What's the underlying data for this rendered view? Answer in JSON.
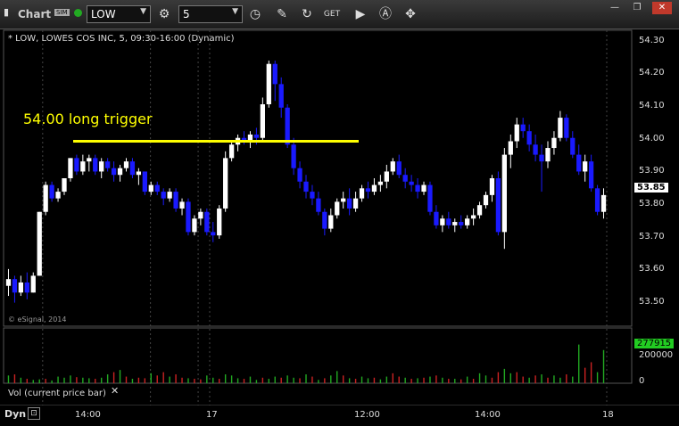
{
  "window": {
    "title": "Chart",
    "sim_badge": "SIM",
    "symbol": "LOW",
    "interval": "5",
    "win_buttons": [
      "—",
      "❐",
      "✕"
    ]
  },
  "chart": {
    "header": "* LOW, LOWES COS INC, 5, 09:30-16:00 (Dynamic)",
    "watermark": "© eSignal, 2014",
    "annotation": "54.00 long trigger",
    "last_price": "53.85",
    "price_ticks": [
      "54.30",
      "54.20",
      "54.10",
      "54.00",
      "53.90",
      "53.80",
      "53.70",
      "53.60",
      "53.50"
    ],
    "time_ticks": [
      "14:00",
      "17",
      "12:00",
      "14:00",
      "18"
    ],
    "volume_label": "Vol (current price bar)",
    "volume_last": "277915",
    "volume_ticks": [
      "200000",
      "0"
    ],
    "footer_mode": "Dyn",
    "colors": {
      "up": "#ffffff",
      "down": "#1a1aff",
      "trigger": "#ffff00",
      "vol_up": "#22aa22",
      "vol_down": "#cc2222"
    }
  },
  "chart_data": {
    "type": "candlestick",
    "ylim": [
      53.45,
      54.33
    ],
    "trigger_level": 54.0,
    "candles": [
      [
        53.57,
        53.62,
        53.54,
        53.59
      ],
      [
        53.59,
        53.6,
        53.52,
        53.55
      ],
      [
        53.55,
        53.6,
        53.54,
        53.58
      ],
      [
        53.58,
        53.61,
        53.53,
        53.55
      ],
      [
        53.55,
        53.61,
        53.55,
        53.6
      ],
      [
        53.6,
        53.79,
        53.6,
        53.79
      ],
      [
        53.79,
        53.88,
        53.78,
        53.87
      ],
      [
        53.87,
        53.88,
        53.82,
        53.83
      ],
      [
        53.83,
        53.86,
        53.82,
        53.85
      ],
      [
        53.85,
        53.89,
        53.84,
        53.89
      ],
      [
        53.89,
        53.95,
        53.88,
        53.95
      ],
      [
        53.95,
        53.96,
        53.9,
        53.91
      ],
      [
        53.91,
        53.96,
        53.9,
        53.94
      ],
      [
        53.94,
        53.96,
        53.91,
        53.95
      ],
      [
        53.95,
        53.96,
        53.9,
        53.91
      ],
      [
        53.91,
        53.95,
        53.89,
        53.94
      ],
      [
        53.94,
        53.95,
        53.91,
        53.92
      ],
      [
        53.92,
        53.94,
        53.88,
        53.9
      ],
      [
        53.9,
        53.93,
        53.88,
        53.92
      ],
      [
        53.92,
        53.95,
        53.91,
        53.94
      ],
      [
        53.94,
        53.95,
        53.89,
        53.9
      ],
      [
        53.9,
        53.92,
        53.87,
        53.91
      ],
      [
        53.91,
        53.91,
        53.84,
        53.85
      ],
      [
        53.85,
        53.88,
        53.84,
        53.87
      ],
      [
        53.87,
        53.88,
        53.84,
        53.85
      ],
      [
        53.85,
        53.86,
        53.81,
        53.83
      ],
      [
        53.83,
        53.86,
        53.82,
        53.85
      ],
      [
        53.85,
        53.86,
        53.79,
        53.8
      ],
      [
        53.8,
        53.83,
        53.78,
        53.82
      ],
      [
        53.82,
        53.83,
        53.72,
        53.73
      ],
      [
        53.73,
        53.78,
        53.72,
        53.77
      ],
      [
        53.77,
        53.8,
        53.75,
        53.79
      ],
      [
        53.79,
        53.8,
        53.72,
        53.73
      ],
      [
        53.73,
        53.76,
        53.7,
        53.72
      ],
      [
        53.72,
        53.81,
        53.71,
        53.8
      ],
      [
        53.8,
        53.97,
        53.79,
        53.95
      ],
      [
        53.95,
        54.0,
        53.94,
        53.99
      ],
      [
        53.99,
        54.02,
        53.97,
        54.01
      ],
      [
        54.01,
        54.03,
        53.99,
        54.0
      ],
      [
        54.0,
        54.03,
        53.98,
        54.02
      ],
      [
        54.02,
        54.04,
        53.99,
        54.01
      ],
      [
        54.01,
        54.13,
        54.0,
        54.11
      ],
      [
        54.11,
        54.24,
        54.1,
        54.23
      ],
      [
        54.23,
        54.24,
        54.12,
        54.17
      ],
      [
        54.17,
        54.19,
        54.07,
        54.1
      ],
      [
        54.1,
        54.11,
        53.98,
        53.99
      ],
      [
        53.99,
        54.01,
        53.9,
        53.92
      ],
      [
        53.92,
        53.94,
        53.86,
        53.88
      ],
      [
        53.88,
        53.9,
        53.83,
        53.85
      ],
      [
        53.85,
        53.87,
        53.81,
        53.83
      ],
      [
        53.83,
        53.85,
        53.78,
        53.79
      ],
      [
        53.79,
        53.8,
        53.72,
        53.74
      ],
      [
        53.74,
        53.8,
        53.73,
        53.78
      ],
      [
        53.78,
        53.83,
        53.77,
        53.82
      ],
      [
        53.82,
        53.85,
        53.8,
        53.83
      ],
      [
        53.83,
        53.86,
        53.78,
        53.8
      ],
      [
        53.8,
        53.85,
        53.79,
        53.83
      ],
      [
        53.83,
        53.87,
        53.82,
        53.86
      ],
      [
        53.86,
        53.88,
        53.83,
        53.85
      ],
      [
        53.85,
        53.89,
        53.84,
        53.87
      ],
      [
        53.87,
        53.9,
        53.85,
        53.88
      ],
      [
        53.88,
        53.93,
        53.86,
        53.91
      ],
      [
        53.91,
        53.95,
        53.9,
        53.94
      ],
      [
        53.94,
        53.96,
        53.89,
        53.9
      ],
      [
        53.9,
        53.92,
        53.86,
        53.88
      ],
      [
        53.88,
        53.9,
        53.85,
        53.87
      ],
      [
        53.87,
        53.89,
        53.83,
        53.85
      ],
      [
        53.85,
        53.88,
        53.84,
        53.87
      ],
      [
        53.87,
        53.88,
        53.78,
        53.79
      ],
      [
        53.79,
        53.81,
        53.74,
        53.75
      ],
      [
        53.75,
        53.78,
        53.73,
        53.77
      ],
      [
        53.77,
        53.79,
        53.74,
        53.75
      ],
      [
        53.75,
        53.77,
        53.73,
        53.76
      ],
      [
        53.76,
        53.78,
        53.74,
        53.75
      ],
      [
        53.75,
        53.78,
        53.74,
        53.77
      ],
      [
        53.77,
        53.8,
        53.75,
        53.78
      ],
      [
        53.78,
        53.82,
        53.77,
        53.81
      ],
      [
        53.81,
        53.85,
        53.8,
        53.84
      ],
      [
        53.84,
        53.9,
        53.82,
        53.89
      ],
      [
        53.89,
        53.91,
        53.72,
        53.73
      ],
      [
        53.73,
        53.98,
        53.68,
        53.96
      ],
      [
        53.96,
        54.02,
        53.92,
        54.0
      ],
      [
        54.0,
        54.07,
        53.98,
        54.05
      ],
      [
        54.05,
        54.07,
        54.01,
        54.03
      ],
      [
        54.03,
        54.05,
        53.97,
        53.99
      ],
      [
        53.99,
        54.02,
        53.94,
        53.96
      ],
      [
        53.96,
        53.99,
        53.85,
        53.94
      ],
      [
        53.94,
        54.0,
        53.92,
        53.98
      ],
      [
        53.98,
        54.03,
        53.96,
        54.01
      ],
      [
        54.01,
        54.09,
        54.0,
        54.07
      ],
      [
        54.07,
        54.08,
        54.0,
        54.01
      ],
      [
        54.01,
        54.03,
        53.95,
        53.96
      ],
      [
        53.96,
        53.99,
        53.9,
        53.91
      ],
      [
        53.91,
        53.96,
        53.88,
        53.94
      ],
      [
        53.94,
        53.96,
        53.85,
        53.86
      ],
      [
        53.86,
        53.87,
        53.78,
        53.79
      ],
      [
        53.79,
        53.86,
        53.77,
        53.84
      ]
    ],
    "volumes": [
      [
        0.14,
        1
      ],
      [
        0.16,
        0
      ],
      [
        0.1,
        1
      ],
      [
        0.08,
        0
      ],
      [
        0.06,
        1
      ],
      [
        0.07,
        1
      ],
      [
        0.08,
        0
      ],
      [
        0.05,
        1
      ],
      [
        0.12,
        1
      ],
      [
        0.1,
        1
      ],
      [
        0.14,
        1
      ],
      [
        0.11,
        0
      ],
      [
        0.1,
        1
      ],
      [
        0.09,
        1
      ],
      [
        0.08,
        0
      ],
      [
        0.1,
        1
      ],
      [
        0.16,
        1
      ],
      [
        0.2,
        0
      ],
      [
        0.24,
        1
      ],
      [
        0.12,
        0
      ],
      [
        0.08,
        1
      ],
      [
        0.1,
        0
      ],
      [
        0.09,
        0
      ],
      [
        0.18,
        1
      ],
      [
        0.14,
        0
      ],
      [
        0.2,
        0
      ],
      [
        0.12,
        1
      ],
      [
        0.16,
        0
      ],
      [
        0.1,
        0
      ],
      [
        0.09,
        1
      ],
      [
        0.08,
        0
      ],
      [
        0.07,
        0
      ],
      [
        0.14,
        1
      ],
      [
        0.1,
        1
      ],
      [
        0.08,
        0
      ],
      [
        0.16,
        1
      ],
      [
        0.14,
        1
      ],
      [
        0.09,
        1
      ],
      [
        0.08,
        0
      ],
      [
        0.12,
        1
      ],
      [
        0.06,
        1
      ],
      [
        0.1,
        0
      ],
      [
        0.08,
        1
      ],
      [
        0.12,
        1
      ],
      [
        0.1,
        0
      ],
      [
        0.14,
        1
      ],
      [
        0.1,
        1
      ],
      [
        0.09,
        0
      ],
      [
        0.16,
        1
      ],
      [
        0.12,
        0
      ],
      [
        0.06,
        1
      ],
      [
        0.09,
        0
      ],
      [
        0.14,
        1
      ],
      [
        0.22,
        1
      ],
      [
        0.14,
        0
      ],
      [
        0.09,
        1
      ],
      [
        0.08,
        0
      ],
      [
        0.12,
        1
      ],
      [
        0.09,
        1
      ],
      [
        0.1,
        0
      ],
      [
        0.07,
        1
      ],
      [
        0.12,
        1
      ],
      [
        0.18,
        0
      ],
      [
        0.12,
        0
      ],
      [
        0.1,
        1
      ],
      [
        0.08,
        0
      ],
      [
        0.09,
        1
      ],
      [
        0.1,
        0
      ],
      [
        0.12,
        1
      ],
      [
        0.14,
        0
      ],
      [
        0.1,
        1
      ],
      [
        0.08,
        0
      ],
      [
        0.08,
        1
      ],
      [
        0.07,
        0
      ],
      [
        0.12,
        1
      ],
      [
        0.08,
        0
      ],
      [
        0.18,
        1
      ],
      [
        0.14,
        1
      ],
      [
        0.1,
        0
      ],
      [
        0.2,
        0
      ],
      [
        0.26,
        1
      ],
      [
        0.18,
        1
      ],
      [
        0.2,
        0
      ],
      [
        0.12,
        0
      ],
      [
        0.1,
        1
      ],
      [
        0.14,
        0
      ],
      [
        0.16,
        1
      ],
      [
        0.1,
        0
      ],
      [
        0.14,
        1
      ],
      [
        0.1,
        1
      ],
      [
        0.16,
        0
      ],
      [
        0.12,
        1
      ],
      [
        0.7,
        1
      ],
      [
        0.28,
        0
      ],
      [
        0.38,
        0
      ],
      [
        0.2,
        1
      ],
      [
        0.6,
        1
      ]
    ]
  }
}
